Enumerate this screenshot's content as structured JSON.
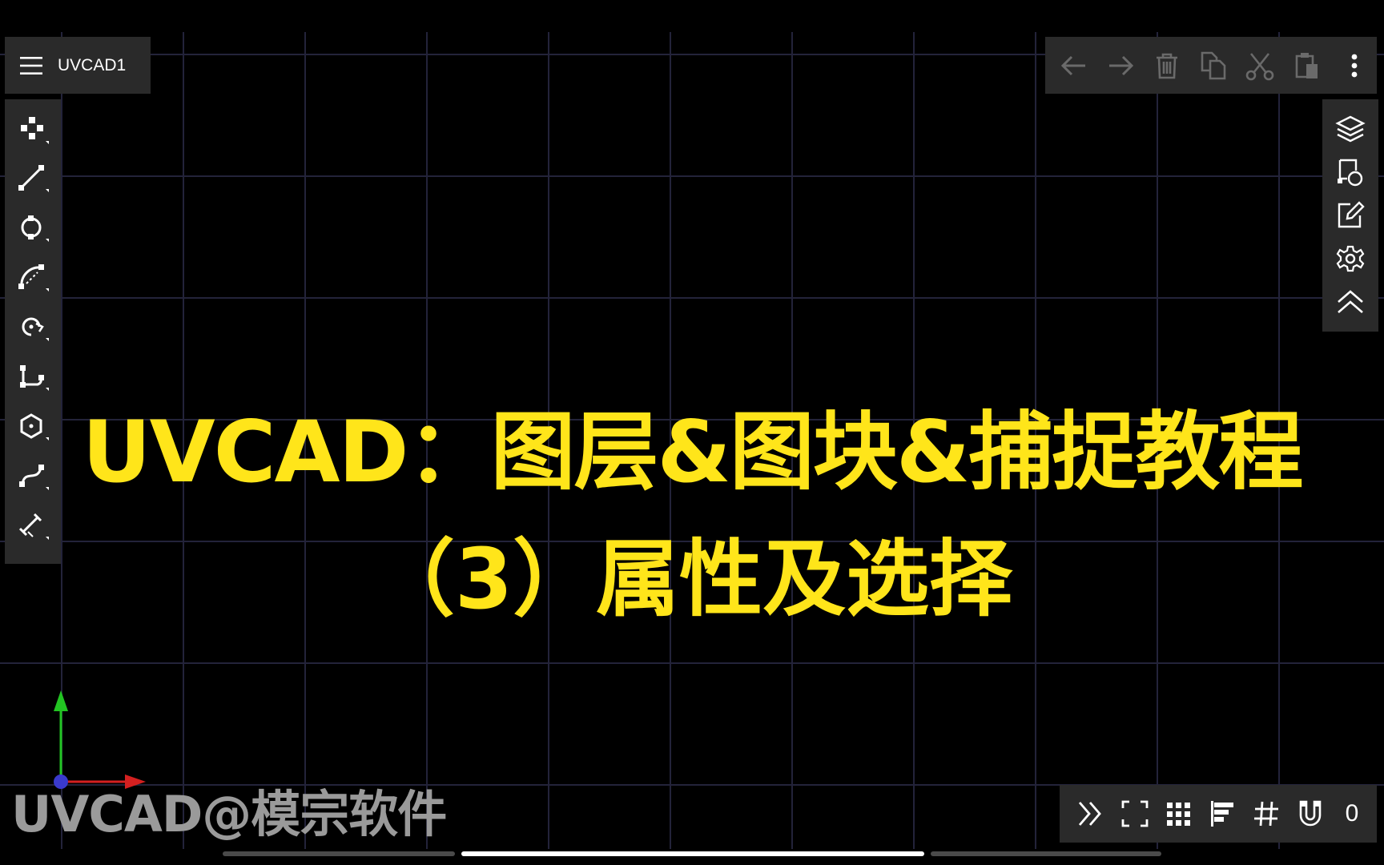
{
  "app": {
    "title": "UVCAD1",
    "menu_icon": "hamburger-menu-icon"
  },
  "colors": {
    "background": "#000000",
    "grid_line": "#23233a",
    "toolbar_bg": "#2a2a2a",
    "icon": "#ffffff",
    "icon_disabled": "#6a6a6a",
    "headline": "#ffe51a",
    "watermark": "#9a9a9a",
    "axis_y": "#22c422",
    "axis_x": "#d42020",
    "axis_origin": "#3a3acc"
  },
  "left_tools": [
    {
      "name": "select-tool",
      "icon": "select-points-icon"
    },
    {
      "name": "line-tool",
      "icon": "line-icon"
    },
    {
      "name": "circle-tool",
      "icon": "circle-icon"
    },
    {
      "name": "arc-tool",
      "icon": "arc-icon"
    },
    {
      "name": "rotate-tool",
      "icon": "rotate-icon"
    },
    {
      "name": "polyline-tool",
      "icon": "polyline-icon"
    },
    {
      "name": "polygon-tool",
      "icon": "polygon-icon"
    },
    {
      "name": "curve-tool",
      "icon": "curve-icon"
    },
    {
      "name": "dimension-tool",
      "icon": "dimension-icon"
    }
  ],
  "edit_toolbar": [
    {
      "name": "undo",
      "icon": "arrow-left-icon"
    },
    {
      "name": "redo",
      "icon": "arrow-right-icon"
    },
    {
      "name": "delete",
      "icon": "trash-icon"
    },
    {
      "name": "copy",
      "icon": "copy-icon"
    },
    {
      "name": "cut",
      "icon": "scissors-icon"
    },
    {
      "name": "paste",
      "icon": "paste-icon"
    },
    {
      "name": "more",
      "icon": "more-vertical-icon"
    }
  ],
  "right_tools": [
    {
      "name": "layers",
      "icon": "layers-icon"
    },
    {
      "name": "blocks",
      "icon": "block-icon"
    },
    {
      "name": "properties",
      "icon": "edit-icon"
    },
    {
      "name": "settings",
      "icon": "gear-icon"
    },
    {
      "name": "collapse",
      "icon": "chevron-double-up-icon"
    }
  ],
  "status_toolbar": {
    "items": [
      {
        "name": "expand",
        "icon": "chevron-double-right-icon"
      },
      {
        "name": "fullscreen",
        "icon": "fullscreen-icon"
      },
      {
        "name": "grid-toggle",
        "icon": "grid-dots-icon"
      },
      {
        "name": "align",
        "icon": "align-icon"
      },
      {
        "name": "grid-snap",
        "icon": "hash-icon"
      },
      {
        "name": "magnet-snap",
        "icon": "magnet-icon"
      }
    ],
    "snap_count": "0"
  },
  "headline": {
    "line1": "UVCAD：图层&图块&捕捉教程",
    "line2": "（3）属性及选择"
  },
  "watermark": "UVCAD@模宗软件"
}
